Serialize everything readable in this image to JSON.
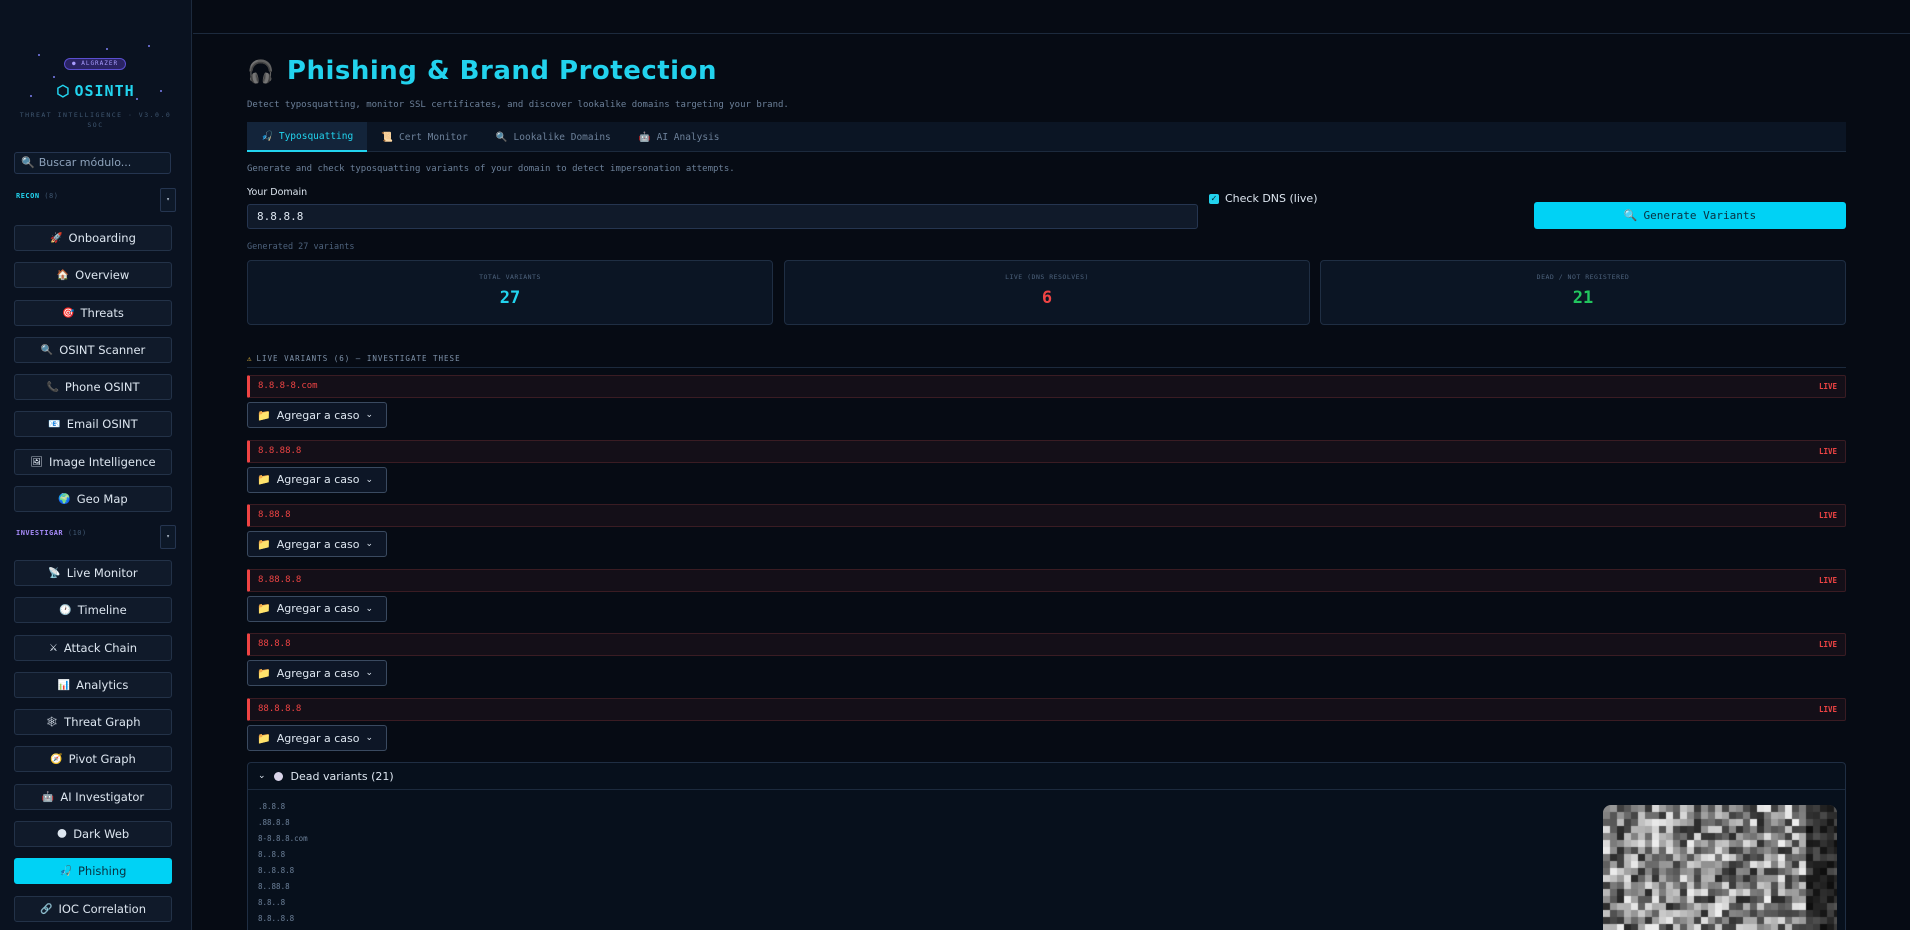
{
  "sidebar": {
    "badge": "● ALGRAZER",
    "title": "OSINTH",
    "title_icon": "⬡",
    "subtitle": "THREAT INTELLIGENCE · V3.0.0 SOC",
    "search_placeholder": "Buscar módulo...",
    "sections": [
      {
        "label": "RECON",
        "count": "(8)",
        "color": "#22d3ee"
      },
      {
        "label": "INVESTIGAR",
        "count": "(10)",
        "color": "#a78bfa"
      }
    ],
    "toggle": "▾",
    "items": [
      {
        "icon": "🚀",
        "label": "Onboarding"
      },
      {
        "icon": "🏠",
        "label": "Overview"
      },
      {
        "icon": "🎯",
        "label": "Threats"
      },
      {
        "icon": "🔍",
        "label": "OSINT Scanner"
      },
      {
        "icon": "📞",
        "label": "Phone OSINT"
      },
      {
        "icon": "📧",
        "label": "Email OSINT"
      },
      {
        "icon": "🖼",
        "label": "Image Intelligence"
      },
      {
        "icon": "🌍",
        "label": "Geo Map"
      },
      {
        "icon": "📡",
        "label": "Live Monitor"
      },
      {
        "icon": "🕐",
        "label": "Timeline"
      },
      {
        "icon": "⚔",
        "label": "Attack Chain"
      },
      {
        "icon": "📊",
        "label": "Analytics"
      },
      {
        "icon": "🕸",
        "label": "Threat Graph"
      },
      {
        "icon": "🧭",
        "label": "Pivot Graph"
      },
      {
        "icon": "🤖",
        "label": "AI Investigator"
      },
      {
        "icon": "🌑",
        "label": "Dark Web"
      },
      {
        "icon": "🎣",
        "label": "Phishing",
        "active": true
      },
      {
        "icon": "🔗",
        "label": "IOC Correlation"
      }
    ]
  },
  "page": {
    "icon": "🎧",
    "title": "Phishing & Brand Protection",
    "subtitle": "Detect typosquatting, monitor SSL certificates, and discover lookalike domains targeting your brand.",
    "tabs": [
      {
        "icon": "🎣",
        "label": "Typosquatting"
      },
      {
        "icon": "📜",
        "label": "Cert Monitor"
      },
      {
        "icon": "🔍",
        "label": "Lookalike Domains"
      },
      {
        "icon": "🤖",
        "label": "AI Analysis"
      }
    ],
    "tab_desc": "Generate and check typosquatting variants of your domain to detect impersonation attempts.",
    "domain_label": "Your Domain",
    "domain_value": "8.8.8.8",
    "check_dns_label": "Check DNS (live)",
    "check_dns_checked": true,
    "generate_button": "Generate Variants",
    "generate_icon": "🔍",
    "generated_text": "Generated 27 variants"
  },
  "stats": [
    {
      "label": "TOTAL VARIANTS",
      "value": "27",
      "color": "#22d3ee"
    },
    {
      "label": "LIVE (DNS RESOLVES)",
      "value": "6",
      "color": "#ef4444"
    },
    {
      "label": "DEAD / NOT REGISTERED",
      "value": "21",
      "color": "#22c55e"
    }
  ],
  "live": {
    "heading": "LIVE VARIANTS (6) — INVESTIGATE THESE",
    "warn_icon": "⚠",
    "tag": "LIVE",
    "case_button": "Agregar a caso",
    "variants": [
      "8.8.8-8.com",
      "8.8.88.8",
      "8.88.8",
      "8.88.8.8",
      "88.8.8",
      "88.8.8.8"
    ]
  },
  "dead": {
    "heading": "Dead variants (21)",
    "items": [
      ".8.8.8",
      ".88.8.8",
      "8-8.8.8.com",
      "8..8.8",
      "8..8.8.8",
      "8..88.8",
      "8.8..8",
      "8.8..8.8"
    ]
  }
}
